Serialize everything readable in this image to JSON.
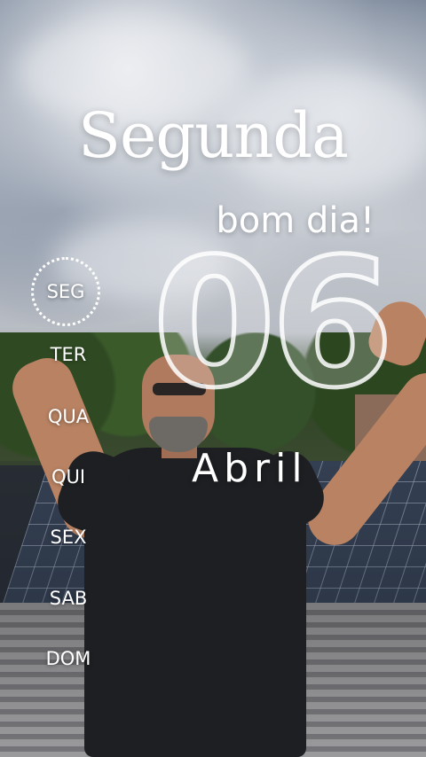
{
  "title": "Segunda",
  "subtitle": "bom dia!",
  "date": {
    "day": "06",
    "month": "Abril"
  },
  "weekdays": [
    {
      "label": "SEG",
      "active": true
    },
    {
      "label": "TER",
      "active": false
    },
    {
      "label": "QUA",
      "active": false
    },
    {
      "label": "QUI",
      "active": false
    },
    {
      "label": "SEX",
      "active": false
    },
    {
      "label": "SAB",
      "active": false
    },
    {
      "label": "DOM",
      "active": false
    }
  ],
  "colors": {
    "text": "#ffffff",
    "shirt": "#1d1f22",
    "skin": "#b98363"
  }
}
